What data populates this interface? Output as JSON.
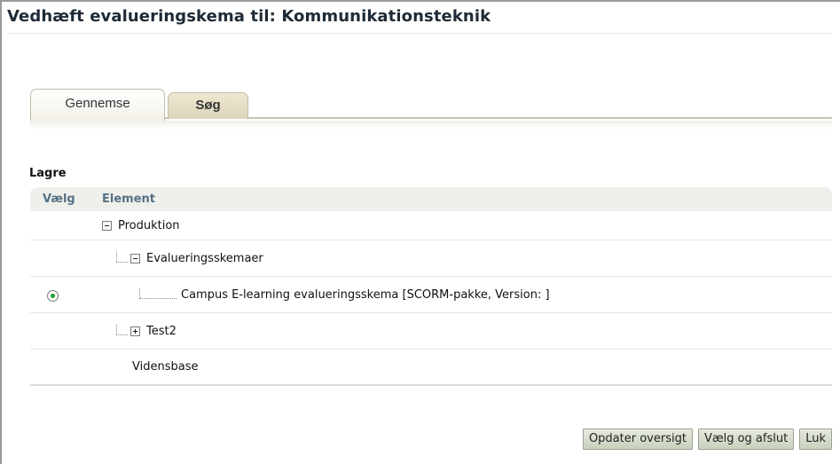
{
  "page": {
    "title": "Vedhæft evalueringskema til: Kommunikationsteknik"
  },
  "tabs": [
    {
      "label": "Gennemse",
      "active": true
    },
    {
      "label": "Søg",
      "active": false
    }
  ],
  "section": {
    "label": "Lagre"
  },
  "table": {
    "columns": [
      "Vælg",
      "Element"
    ],
    "rows": [
      {
        "label": "Produktion",
        "level": 0,
        "toggle": "minus",
        "selectable": false,
        "selected": false
      },
      {
        "label": "Evalueringsskemaer",
        "level": 1,
        "toggle": "minus",
        "selectable": false,
        "selected": false
      },
      {
        "label": "Campus E-learning evalueringsskema [SCORM-pakke, Version: ]",
        "level": 2,
        "toggle": null,
        "selectable": true,
        "selected": true
      },
      {
        "label": "Test2",
        "level": 1,
        "toggle": "plus",
        "selectable": false,
        "selected": false
      },
      {
        "label": "Vidensbase",
        "level": 0,
        "toggle": null,
        "selectable": false,
        "selected": false
      }
    ]
  },
  "buttons": {
    "refresh_label": "Opdater oversigt",
    "select_finish_label": "Vælg og afslut",
    "close_label": "Luk"
  },
  "colors": {
    "title": "#1e2a36",
    "header_text": "#567184",
    "radio_selected": "#1c9d2e",
    "button_bg": "#c9d0bd"
  }
}
